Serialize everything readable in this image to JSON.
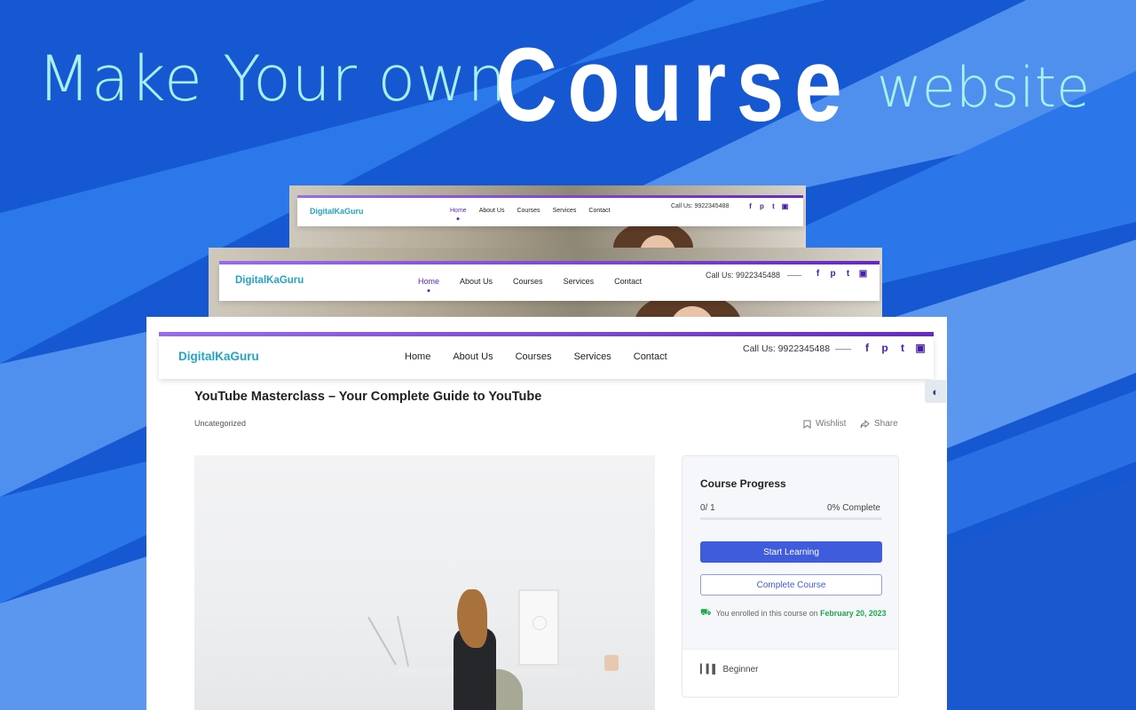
{
  "headline": {
    "left": "Make Your own",
    "middle": "Course",
    "right": "website"
  },
  "site": {
    "logo": "DigitalKaGuru",
    "menu": [
      "Home",
      "About Us",
      "Courses",
      "Services",
      "Contact"
    ],
    "active_menu": "Home",
    "call_us": "Call Us: 9922345488",
    "social_icons": [
      "facebook-icon",
      "pinterest-icon",
      "twitter-icon",
      "youtube-icon"
    ]
  },
  "course": {
    "title": "YouTube Masterclass – Your Complete Guide to YouTube",
    "category": "Uncategorized",
    "wishlist_label": "Wishlist",
    "share_label": "Share"
  },
  "progress_card": {
    "title": "Course Progress",
    "count": "0/ 1",
    "percent_text": "0% Complete",
    "progress": 0,
    "start_button": "Start Learning",
    "complete_button": "Complete Course",
    "enrolled_text": "You enrolled in this course on",
    "enrolled_date": "February 20, 2023",
    "level": "Beginner"
  },
  "colors": {
    "background": "#1a5fd6",
    "headline_light": "#a8f0ea",
    "accent_purple": "#5a26c0",
    "logo": "#22a4c4",
    "primary_button": "#3e5cdb",
    "enrolled_green": "#1da84a"
  }
}
